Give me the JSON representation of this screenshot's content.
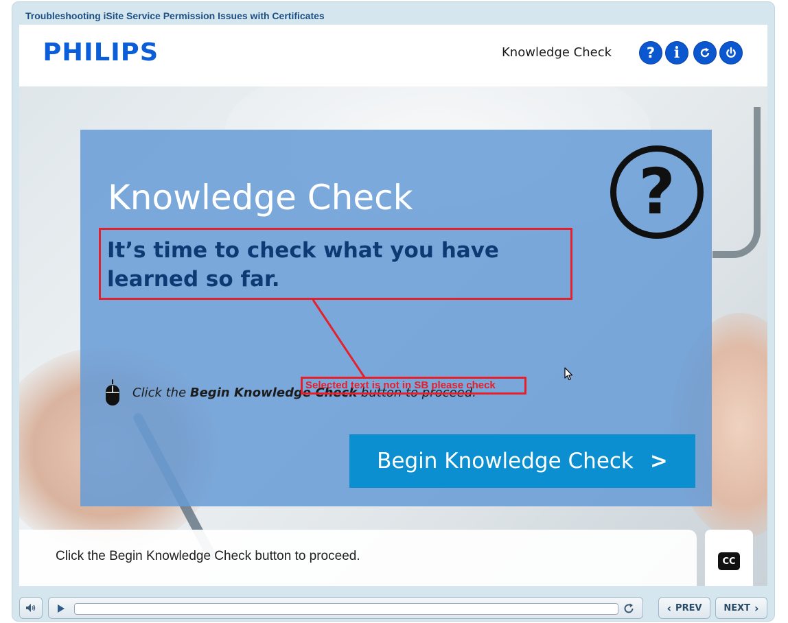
{
  "window": {
    "course_title": "Troubleshooting iSite Service Permission Issues with Certificates"
  },
  "header": {
    "logo_text": "PHILIPS",
    "section_name": "Knowledge Check",
    "buttons": [
      {
        "icon": "help-icon",
        "glyph": "?"
      },
      {
        "icon": "info-icon",
        "glyph": "i"
      },
      {
        "icon": "refresh-icon"
      },
      {
        "icon": "power-icon"
      }
    ],
    "accent_color": "#0b57d0"
  },
  "slide": {
    "title": "Knowledge Check",
    "subtitle": "It’s time to check what you have learned so far.",
    "question_glyph": "?",
    "instruction_prefix": "Click the ",
    "instruction_bold": "Begin Knowledge Check",
    "instruction_suffix": " button to proceed.",
    "begin_button_label": "Begin Knowledge Check",
    "begin_button_chevron": ">",
    "card_color": "#689cd6",
    "button_color": "#0b8fd0"
  },
  "annotation": {
    "comment": "Selected text is not in SB please check",
    "color": "#e3202b"
  },
  "caption": {
    "text": "Click the Begin Knowledge Check button to proceed.",
    "cc_label": "CC"
  },
  "playbar": {
    "progress_fraction": 0,
    "prev_label": "PREV",
    "next_label": "NEXT",
    "prev_chevron": "‹",
    "next_chevron": "›"
  }
}
